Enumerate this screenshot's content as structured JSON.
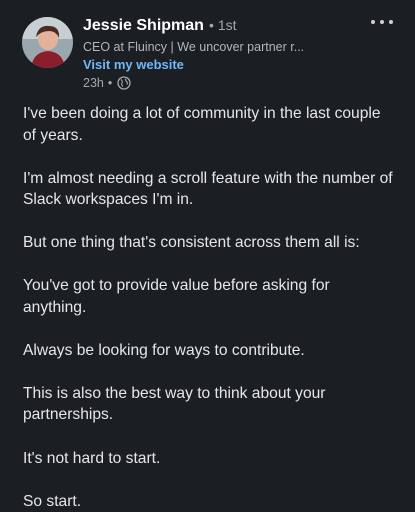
{
  "author": {
    "name": "Jessie Shipman",
    "separator": "•",
    "degree": "1st",
    "headline": "CEO at Fluincy | We uncover partner r...",
    "website_link": "Visit my website",
    "time": "23h",
    "time_separator": "•",
    "visibility_icon": "globe-icon"
  },
  "menu": {
    "icon": "more-options-icon"
  },
  "post": {
    "paragraphs": [
      "I've been doing a lot of community in the last couple of years.",
      "I'm almost needing a scroll feature with the number of Slack workspaces I'm in.",
      "But one thing that's consistent across them all is:",
      "You've got to provide value before asking for anything.",
      "Always be looking for ways to contribute.",
      "This is also the best way to think about your partnerships.",
      "It's not hard to start.",
      "So start."
    ]
  },
  "colors": {
    "background": "#1b1f23",
    "text": "#e6e7e8",
    "link": "#71b7fb",
    "muted": "#a6a8ab"
  }
}
